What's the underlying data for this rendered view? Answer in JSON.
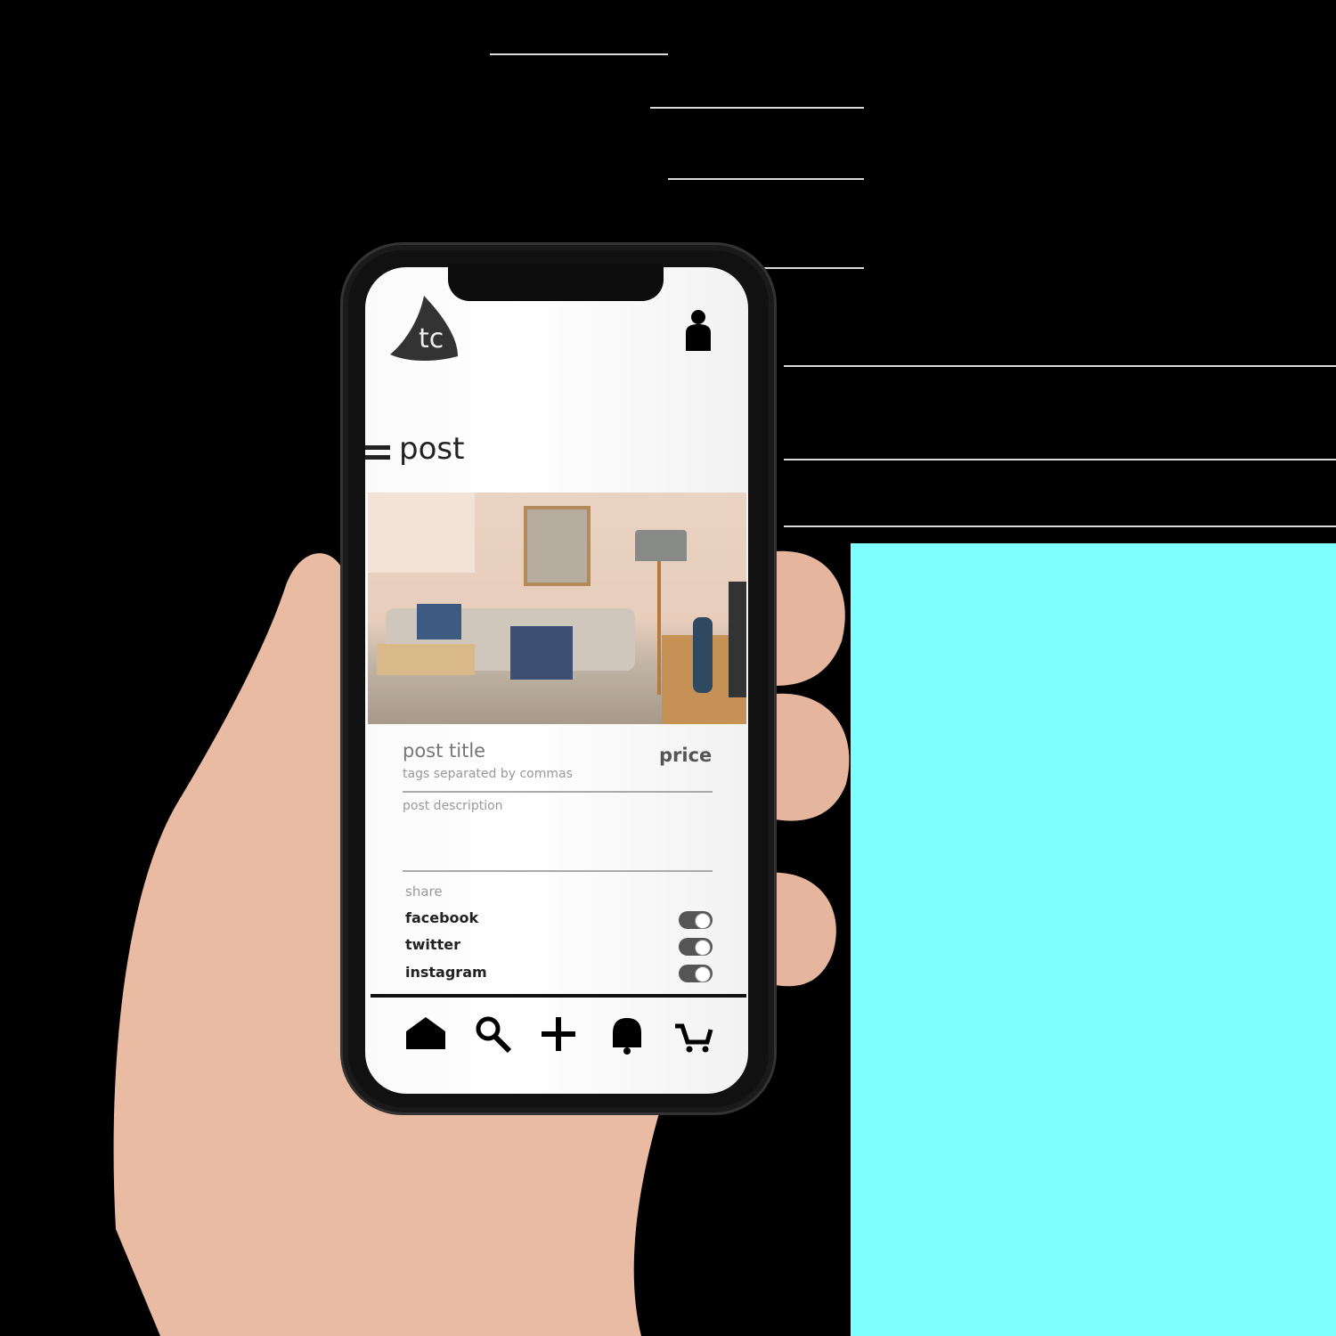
{
  "header": {
    "logo_text": "tc",
    "profile_icon": "person-icon"
  },
  "page_title": "post",
  "post": {
    "title_placeholder": "post title",
    "tags_placeholder": "tags separated by commas",
    "price_label": "price",
    "description_placeholder": "post description"
  },
  "share": {
    "label": "share",
    "options": [
      {
        "label": "facebook",
        "on": true
      },
      {
        "label": "twitter",
        "on": true
      },
      {
        "label": "instagram",
        "on": true
      }
    ]
  },
  "nav": [
    "home-icon",
    "search-icon",
    "plus-icon",
    "bell-icon",
    "cart-icon"
  ]
}
